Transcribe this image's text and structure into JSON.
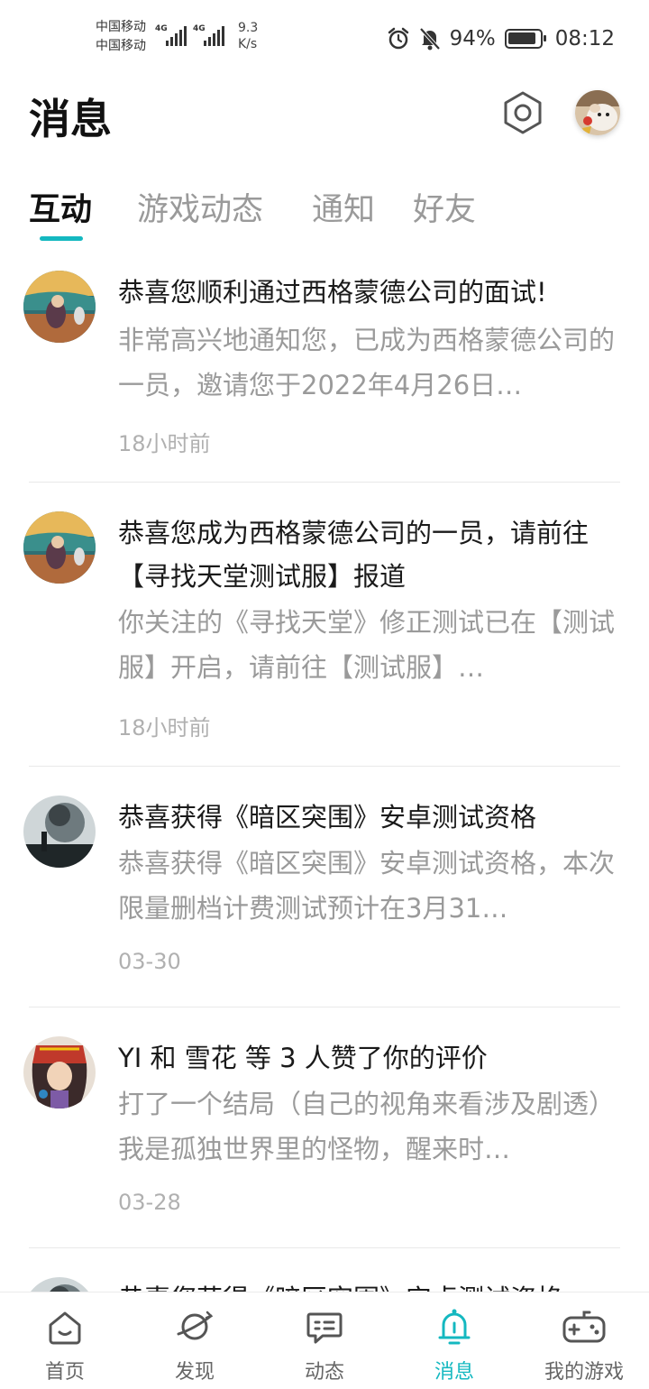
{
  "status_bar": {
    "carrier1": "中国移动",
    "carrier2": "中国移动",
    "net_type": "4G",
    "net_speed_value": "9.3",
    "net_speed_unit": "K/s",
    "battery_percent": "94%",
    "time": "08:12"
  },
  "header": {
    "title": "消息"
  },
  "tabs": [
    {
      "label": "互动",
      "active": true
    },
    {
      "label": "游戏动态",
      "active": false
    },
    {
      "label": "通知",
      "active": false
    },
    {
      "label": "好友",
      "active": false
    }
  ],
  "messages": [
    {
      "title": "恭喜您顺利通过西格蒙德公司的面试!",
      "preview": "非常高兴地通知您，已成为西格蒙德公司的一员，邀请您于2022年4月26日…",
      "time": "18小时前"
    },
    {
      "title": "恭喜您成为西格蒙德公司的一员，请前往【寻找天堂测试服】报道",
      "preview": "你关注的《寻找天堂》修正测试已在【测试服】开启，请前往【测试服】…",
      "time": "18小时前"
    },
    {
      "title": "恭喜获得《暗区突围》安卓测试资格",
      "preview": "恭喜获得《暗区突围》安卓测试资格，本次限量删档计费测试预计在3月31…",
      "time": "03-30"
    },
    {
      "title": "YI 和 雪花 等 3 人赞了你的评价",
      "preview": "打了一个结局（自己的视角来看涉及剧透） 我是孤独世界里的怪物，醒来时…",
      "time": "03-28"
    },
    {
      "title": "恭喜您获得《暗区突围》安卓测试资格",
      "preview": "",
      "time": ""
    }
  ],
  "bottom_nav": [
    {
      "label": "首页",
      "icon": "home-icon",
      "active": false
    },
    {
      "label": "发现",
      "icon": "planet-icon",
      "active": false
    },
    {
      "label": "动态",
      "icon": "chat-icon",
      "active": false
    },
    {
      "label": "消息",
      "icon": "bell-icon",
      "active": true
    },
    {
      "label": "我的游戏",
      "icon": "gamepad-icon",
      "active": false
    }
  ],
  "colors": {
    "accent": "#14b8c0",
    "text_primary": "#1a1a1a",
    "text_secondary": "#9a9a9a"
  }
}
